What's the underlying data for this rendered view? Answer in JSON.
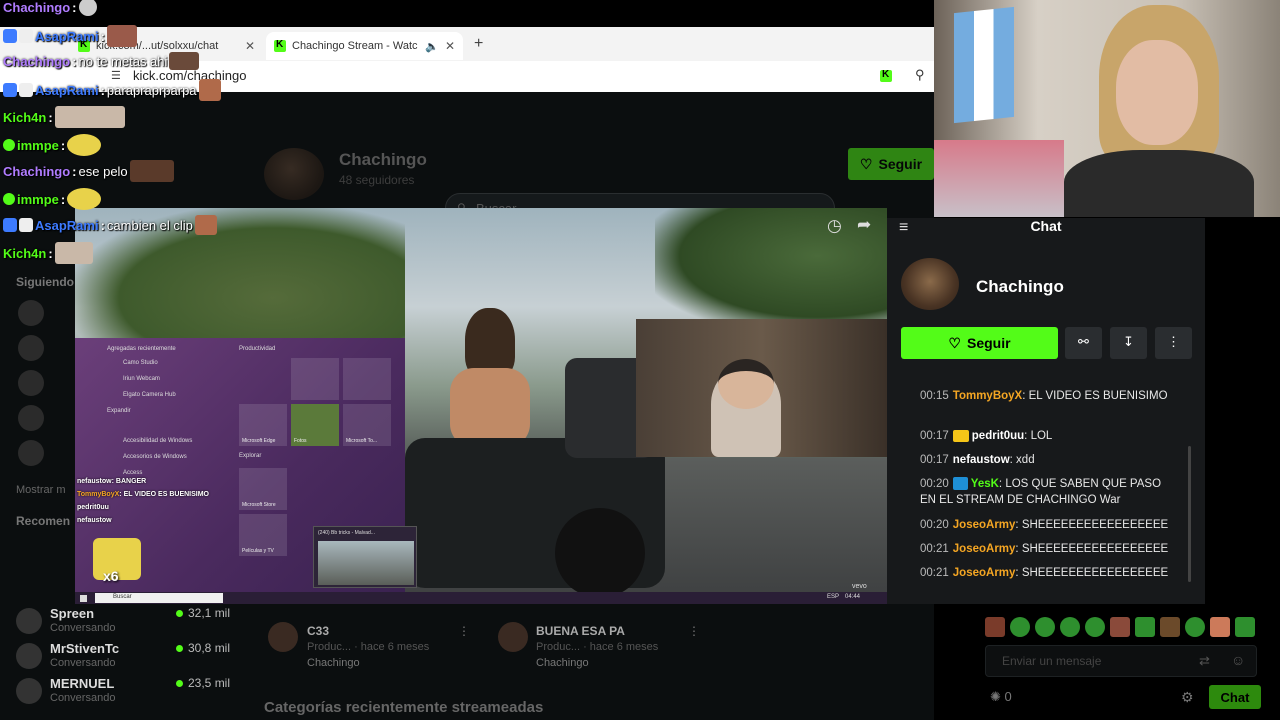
{
  "browser": {
    "tabs": [
      {
        "label": "kick.com/...ut/solxxu/chat"
      },
      {
        "label": "Chachingo Stream - Watc"
      }
    ],
    "url": "kick.com/chachingo"
  },
  "overlay_chat": [
    {
      "user": "Chachingo",
      "color": "#b07cff",
      "text": ""
    },
    {
      "user": "AsapRami",
      "color": "#3d7bff",
      "text": ""
    },
    {
      "user": "Chachingo",
      "color": "#b07cff",
      "text": "no te metas ahi"
    },
    {
      "user": "AsapRami",
      "color": "#3d7bff",
      "text": "parapraprparpa"
    },
    {
      "user": "Kich4n",
      "color": "#53fc18",
      "text": ""
    },
    {
      "user": "immpe",
      "color": "#53fc18",
      "text": ""
    },
    {
      "user": "Chachingo",
      "color": "#b07cff",
      "text": "ese pelo"
    },
    {
      "user": "immpe",
      "color": "#53fc18",
      "text": ""
    },
    {
      "user": "AsapRami",
      "color": "#3d7bff",
      "text": "cambien el clip"
    },
    {
      "user": "Kich4n",
      "color": "#53fc18",
      "text": ""
    }
  ],
  "page": {
    "search_placeholder": "Buscar",
    "channel_name": "Chachingo",
    "followers": "48 seguidores",
    "follow_label": "Seguir",
    "sidebar_sections": {
      "following": "Siguiendo",
      "show_more": "Mostrar m",
      "recommended": "Recomen"
    },
    "sidebar_users": [
      {
        "name": "Spreen",
        "sub": "Conversando",
        "viewers": "32,1 mil"
      },
      {
        "name": "MrStivenTc",
        "sub": "Conversando",
        "viewers": "30,8 mil"
      },
      {
        "name": "MERNUEL",
        "sub": "Conversando",
        "viewers": "23,5 mil"
      }
    ],
    "clips": [
      {
        "title": "C33",
        "meta": "Produc... · hace 6 meses",
        "author": "Chachingo"
      },
      {
        "title": "BUENA ESA PA",
        "meta": "Produc... · hace 6 meses",
        "author": "Chachingo"
      }
    ],
    "recent_categories": "Categorías recientemente streameadas",
    "chat_input_placeholder": "Enviar un mensaje",
    "chat_count": "0",
    "chat_button": "Chat"
  },
  "video": {
    "startmenu": {
      "recent": "Agregadas recientemente",
      "productivity": "Productividad",
      "apps": [
        "Camo Studio",
        "Iriun Webcam",
        "Elgato Camera Hub",
        "Expandir",
        "Accesibilidad de Windows",
        "Accesorios de Windows",
        "Access"
      ],
      "tiles": [
        "Microsoft Edge",
        "Fotos",
        "Microsoft To...",
        "Explorar",
        "Microsoft Store",
        "Películas y TV"
      ],
      "search": "Buscar",
      "clock": "04:44",
      "lang": "ESP"
    },
    "mini_chat": [
      {
        "user": "nefaustow",
        "text": "BANGER"
      },
      {
        "user": "TommyBoyX",
        "text": "EL VIDEO ES BUENISIMO"
      },
      {
        "user": "pedrit0uu",
        "text": ""
      },
      {
        "user": "nefaustow",
        "text": ""
      }
    ],
    "thumb_title": "(240) Bb tricks - Malvad...",
    "badge": "x6",
    "watermark": "vevo"
  },
  "chat_panel": {
    "title": "Chat",
    "streamer": "Chachingo",
    "follow_label": "Seguir",
    "messages": [
      {
        "time": "00:15",
        "user": "TommyBoyX",
        "ucolor": "#f5a623",
        "text": "EL VIDEO ES BUENISIMO"
      },
      {
        "time": "00:17",
        "user": "pedrit0uu",
        "ucolor": "#ffffff",
        "text": "LOL"
      },
      {
        "time": "00:17",
        "user": "nefaustow",
        "ucolor": "#ffffff",
        "text": "xdd"
      },
      {
        "time": "00:20",
        "user": "YesK",
        "ucolor": "#53fc18",
        "text": "LOS QUE SABEN QUE PASO EN EL STREAM DE CHACHINGO War"
      },
      {
        "time": "00:20",
        "user": "JoseoArmy",
        "ucolor": "#f5a623",
        "text": "SHEEEEEEEEEEEEEEEEE"
      },
      {
        "time": "00:21",
        "user": "JoseoArmy",
        "ucolor": "#f5a623",
        "text": "SHEEEEEEEEEEEEEEEEE"
      },
      {
        "time": "00:21",
        "user": "JoseoArmy",
        "ucolor": "#f5a623",
        "text": "SHEEEEEEEEEEEEEEEEE"
      }
    ]
  },
  "colors": {
    "kick_green": "#53fc18",
    "panel": "#17191b",
    "page_bg": "#0b0e0f"
  }
}
